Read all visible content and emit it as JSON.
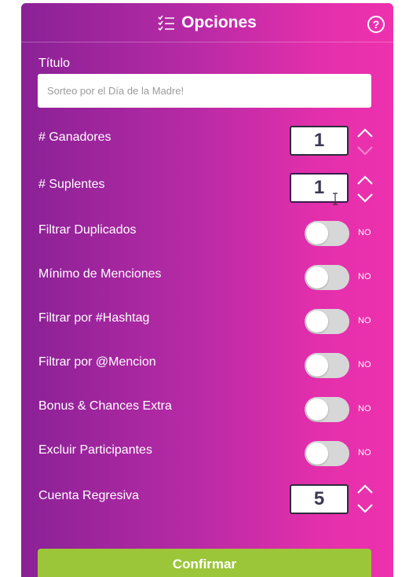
{
  "header": {
    "title": "Opciones",
    "list_icon": "checklist-icon",
    "help_icon": "help-circle-icon",
    "help_glyph": "?"
  },
  "title_field": {
    "label": "Título",
    "placeholder": "Sorteo por el Día de la Madre!"
  },
  "winners": {
    "label": "# Ganadores",
    "value": "1"
  },
  "alternates": {
    "label": "# Suplentes",
    "value": "1"
  },
  "toggles": [
    {
      "label": "Filtrar Duplicados",
      "state": "NO",
      "on": false
    },
    {
      "label": "Mínimo de Menciones",
      "state": "NO",
      "on": false
    },
    {
      "label": "Filtrar por #Hashtag",
      "state": "NO",
      "on": false
    },
    {
      "label": "Filtrar por @Mencion",
      "state": "NO",
      "on": false
    },
    {
      "label": "Bonus & Chances Extra",
      "state": "NO",
      "on": false
    },
    {
      "label": "Excluir Participantes",
      "state": "NO",
      "on": false
    }
  ],
  "countdown": {
    "label": "Cuenta Regresiva",
    "value": "5"
  },
  "confirm_label": "Confirmar",
  "colors": {
    "gradient_start": "#8a2196",
    "gradient_end": "#ee31ae",
    "confirm": "#9cc63a",
    "toggle_off": "#d7d7d7"
  }
}
